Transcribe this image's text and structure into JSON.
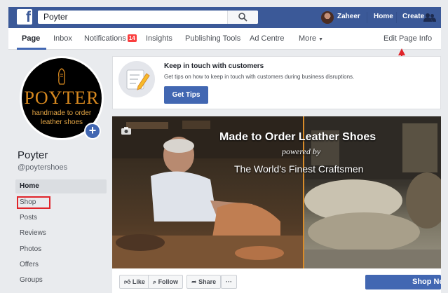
{
  "topbar": {
    "logo": "f",
    "search_value": "Poyter",
    "user_name": "Zaheer",
    "home_label": "Home",
    "create_label": "Create",
    "friends_icon": "friends-icon",
    "bar_color": "#3b5998"
  },
  "subnav": {
    "page_tab": "Page",
    "inbox_tab": "Inbox",
    "notifications_tab": "Notifications",
    "notifications_count": "14",
    "insights_tab": "Insights",
    "publishing_tools_tab": "Publishing Tools",
    "ad_centre_tab": "Ad Centre",
    "more_tab": "More",
    "edit_page_info": "Edit Page Info"
  },
  "profile": {
    "logo_word": "POYTER",
    "tagline_1": "handmade to order",
    "tagline_2": "leather shoes",
    "page_name": "Poyter",
    "page_handle": "@poytershoes"
  },
  "sidebar": {
    "items": [
      {
        "label": "Home"
      },
      {
        "label": "Shop"
      },
      {
        "label": "Posts"
      },
      {
        "label": "Reviews"
      },
      {
        "label": "Photos"
      },
      {
        "label": "Offers"
      },
      {
        "label": "Groups"
      }
    ]
  },
  "card": {
    "title": "Keep in touch with customers",
    "description": "Get tips on how to keep in touch with customers during business disruptions.",
    "button": "Get Tips"
  },
  "cover": {
    "title": "Made to Order Leather Shoes",
    "powered": "powered by",
    "subtitle": "The World's Finest Craftsmen"
  },
  "actions": {
    "like": "Like",
    "follow": "Follow",
    "share": "Share",
    "more": "···",
    "shop_now": "Shop Now"
  },
  "colors": {
    "accent": "#4267b2",
    "highlight_red": "#e0242a"
  }
}
